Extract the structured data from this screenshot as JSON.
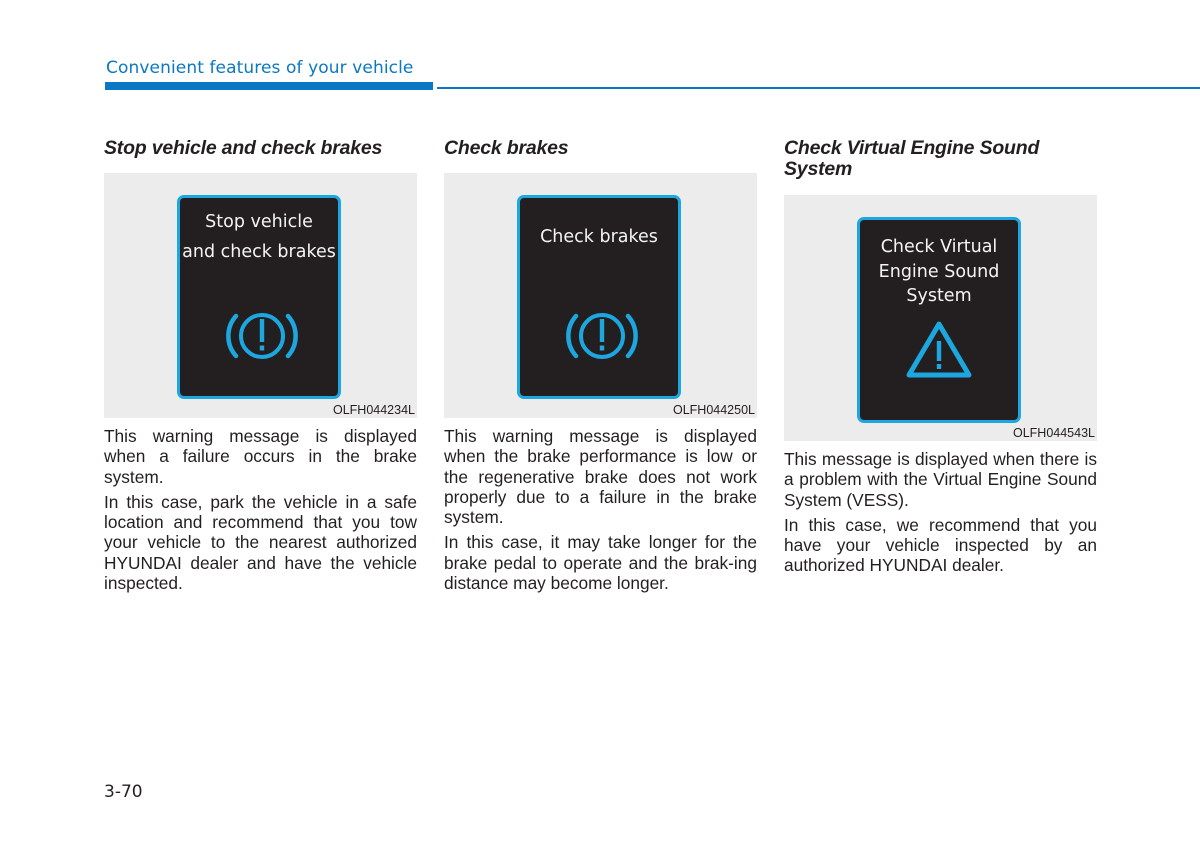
{
  "header": {
    "section_title": "Convenient features of your vehicle",
    "accent_color": "#0a78c2"
  },
  "sections": [
    {
      "title": "Stop vehicle and check brakes",
      "display": {
        "lines": [
          "Stop vehicle",
          "and check brakes"
        ],
        "icon": "brake-warning-icon",
        "figure_code": "OLFH044234L"
      },
      "paragraphs": [
        "This warning message is displayed when a failure occurs in the brake system.",
        "In this case, park the vehicle in a safe location and recommend that you tow your vehicle to the nearest authorized HYUNDAI dealer and have the vehicle inspected."
      ]
    },
    {
      "title": "Check brakes",
      "display": {
        "lines": [
          "Check brakes"
        ],
        "icon": "brake-warning-icon",
        "figure_code": "OLFH044250L"
      },
      "paragraphs": [
        "This warning message is displayed when the brake performance is low or the regenerative brake does not work properly due to a failure in the brake system.",
        "In this case, it may take longer for the brake pedal to operate and the brak-ing distance may become longer."
      ]
    },
    {
      "title": "Check Virtual Engine Sound System",
      "display": {
        "lines": [
          "Check Virtual",
          "Engine Sound",
          "System"
        ],
        "icon": "warning-triangle-icon",
        "figure_code": "OLFH044543L"
      },
      "paragraphs": [
        "This message is displayed when there is a problem with the Virtual Engine Sound System (VESS).",
        "In this case, we recommend that you have your vehicle inspected by an authorized HYUNDAI dealer."
      ]
    }
  ],
  "display_colors": {
    "screen_bg": "#231f20",
    "screen_border": "#1ca7e0",
    "icon": "#1ca7e0"
  },
  "footer": {
    "page_number": "3-70"
  }
}
